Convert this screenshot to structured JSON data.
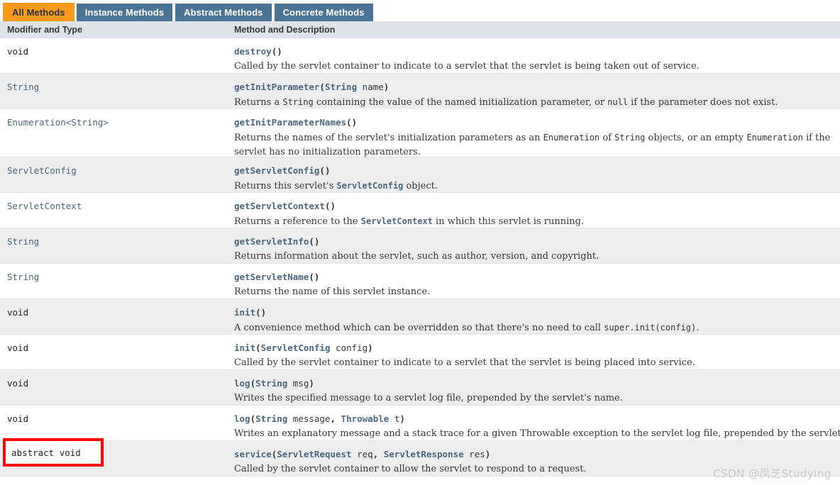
{
  "tabs": [
    {
      "label": "All Methods",
      "active": true
    },
    {
      "label": "Instance Methods",
      "active": false
    },
    {
      "label": "Abstract Methods",
      "active": false
    },
    {
      "label": "Concrete Methods",
      "active": false
    }
  ],
  "columns": {
    "modifier": "Modifier and Type",
    "method": "Method and Description"
  },
  "rows": [
    {
      "modifier": "void",
      "modifier_is_keyword": true,
      "name": "destroy",
      "params": "()",
      "description": "Called by the servlet container to indicate to a servlet that the servlet is being taken out of service."
    },
    {
      "modifier": "String",
      "modifier_is_keyword": false,
      "name": "getInitParameter",
      "params": "(String  name)",
      "description": "Returns a String containing the value of the named initialization parameter, or null if the parameter does not exist."
    },
    {
      "modifier": "Enumeration<String>",
      "modifier_is_keyword": false,
      "name": "getInitParameterNames",
      "params": "()",
      "description": "Returns the names of the servlet's initialization parameters as an Enumeration of String objects, or an empty Enumeration if the servlet has no initialization parameters."
    },
    {
      "modifier": "ServletConfig",
      "modifier_is_keyword": false,
      "name": "getServletConfig",
      "params": "()",
      "description": "Returns this servlet's ServletConfig object."
    },
    {
      "modifier": "ServletContext",
      "modifier_is_keyword": false,
      "name": "getServletContext",
      "params": "()",
      "description": "Returns a reference to the ServletContext in which this servlet is running."
    },
    {
      "modifier": "String",
      "modifier_is_keyword": false,
      "name": "getServletInfo",
      "params": "()",
      "description": "Returns information about the servlet, such as author, version, and copyright."
    },
    {
      "modifier": "String",
      "modifier_is_keyword": false,
      "name": "getServletName",
      "params": "()",
      "description": "Returns the name of this servlet instance."
    },
    {
      "modifier": "void",
      "modifier_is_keyword": true,
      "name": "init",
      "params": "()",
      "description": "A convenience method which can be overridden so that there's no need to call super.init(config)."
    },
    {
      "modifier": "void",
      "modifier_is_keyword": true,
      "name": "init",
      "params": "(ServletConfig  config)",
      "description": "Called by the servlet container to indicate to a servlet that the servlet is being placed into service."
    },
    {
      "modifier": "void",
      "modifier_is_keyword": true,
      "name": "log",
      "params": "(String  msg)",
      "description": "Writes the specified message to a servlet log file, prepended by the servlet's name."
    },
    {
      "modifier": "void",
      "modifier_is_keyword": true,
      "name": "log",
      "params": "(String  message, Throwable  t)",
      "description": "Writes an explanatory message and a stack trace for a given Throwable exception to the servlet log file, prepended by the servlet's name."
    },
    {
      "modifier": "abstract void",
      "modifier_is_keyword": true,
      "name": "service",
      "params": "(ServletRequest  req, ServletResponse  res)",
      "description": "Called by the servlet container to allow the servlet to respond to a request."
    }
  ],
  "annotation": {
    "highlight_label": "abstract void",
    "border_color": "#ff0000"
  },
  "watermark": {
    "text": "CSDN @凤芝Studying"
  },
  "theme": {
    "active_tab_bg": "#f8981d",
    "inactive_tab_bg": "#4a7496",
    "header_bg": "#dee3e9",
    "alt_row_bg": "#eeeeef",
    "link_color": "#4a6782",
    "text_color": "#353833"
  }
}
